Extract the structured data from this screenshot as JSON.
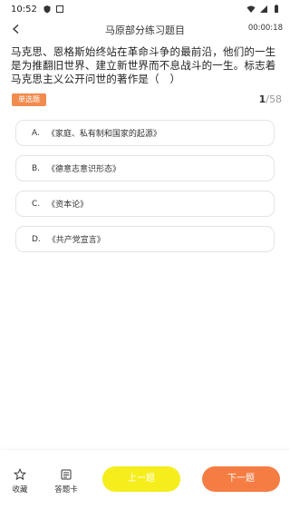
{
  "status": {
    "time": "10:52",
    "battery": "battery"
  },
  "nav": {
    "title": "马原部分练习题目",
    "timer": "00:00:18"
  },
  "question": {
    "text": "马克思、恩格斯始终站在革命斗争的最前沿，他们的一生是为推翻旧世界、建立新世界而不息战斗的一生。标志着马克思主义公开问世的著作是（　）",
    "type": "单选题",
    "current": "1",
    "total": "/58"
  },
  "options": [
    {
      "letter": "A.",
      "text": "《家庭、私有制和国家的起源》"
    },
    {
      "letter": "B.",
      "text": "《德意志意识形态》"
    },
    {
      "letter": "C.",
      "text": "《资本论》"
    },
    {
      "letter": "D.",
      "text": "《共产党宣言》"
    }
  ],
  "bottom": {
    "favorite_label": "收藏",
    "answer_card_label": "答题卡",
    "prev_label": "上一题",
    "next_label": "下一题"
  },
  "colors": {
    "badge": "#f28b4e",
    "prev_button": "#f6ed1c",
    "next_button": "#f57d43"
  }
}
